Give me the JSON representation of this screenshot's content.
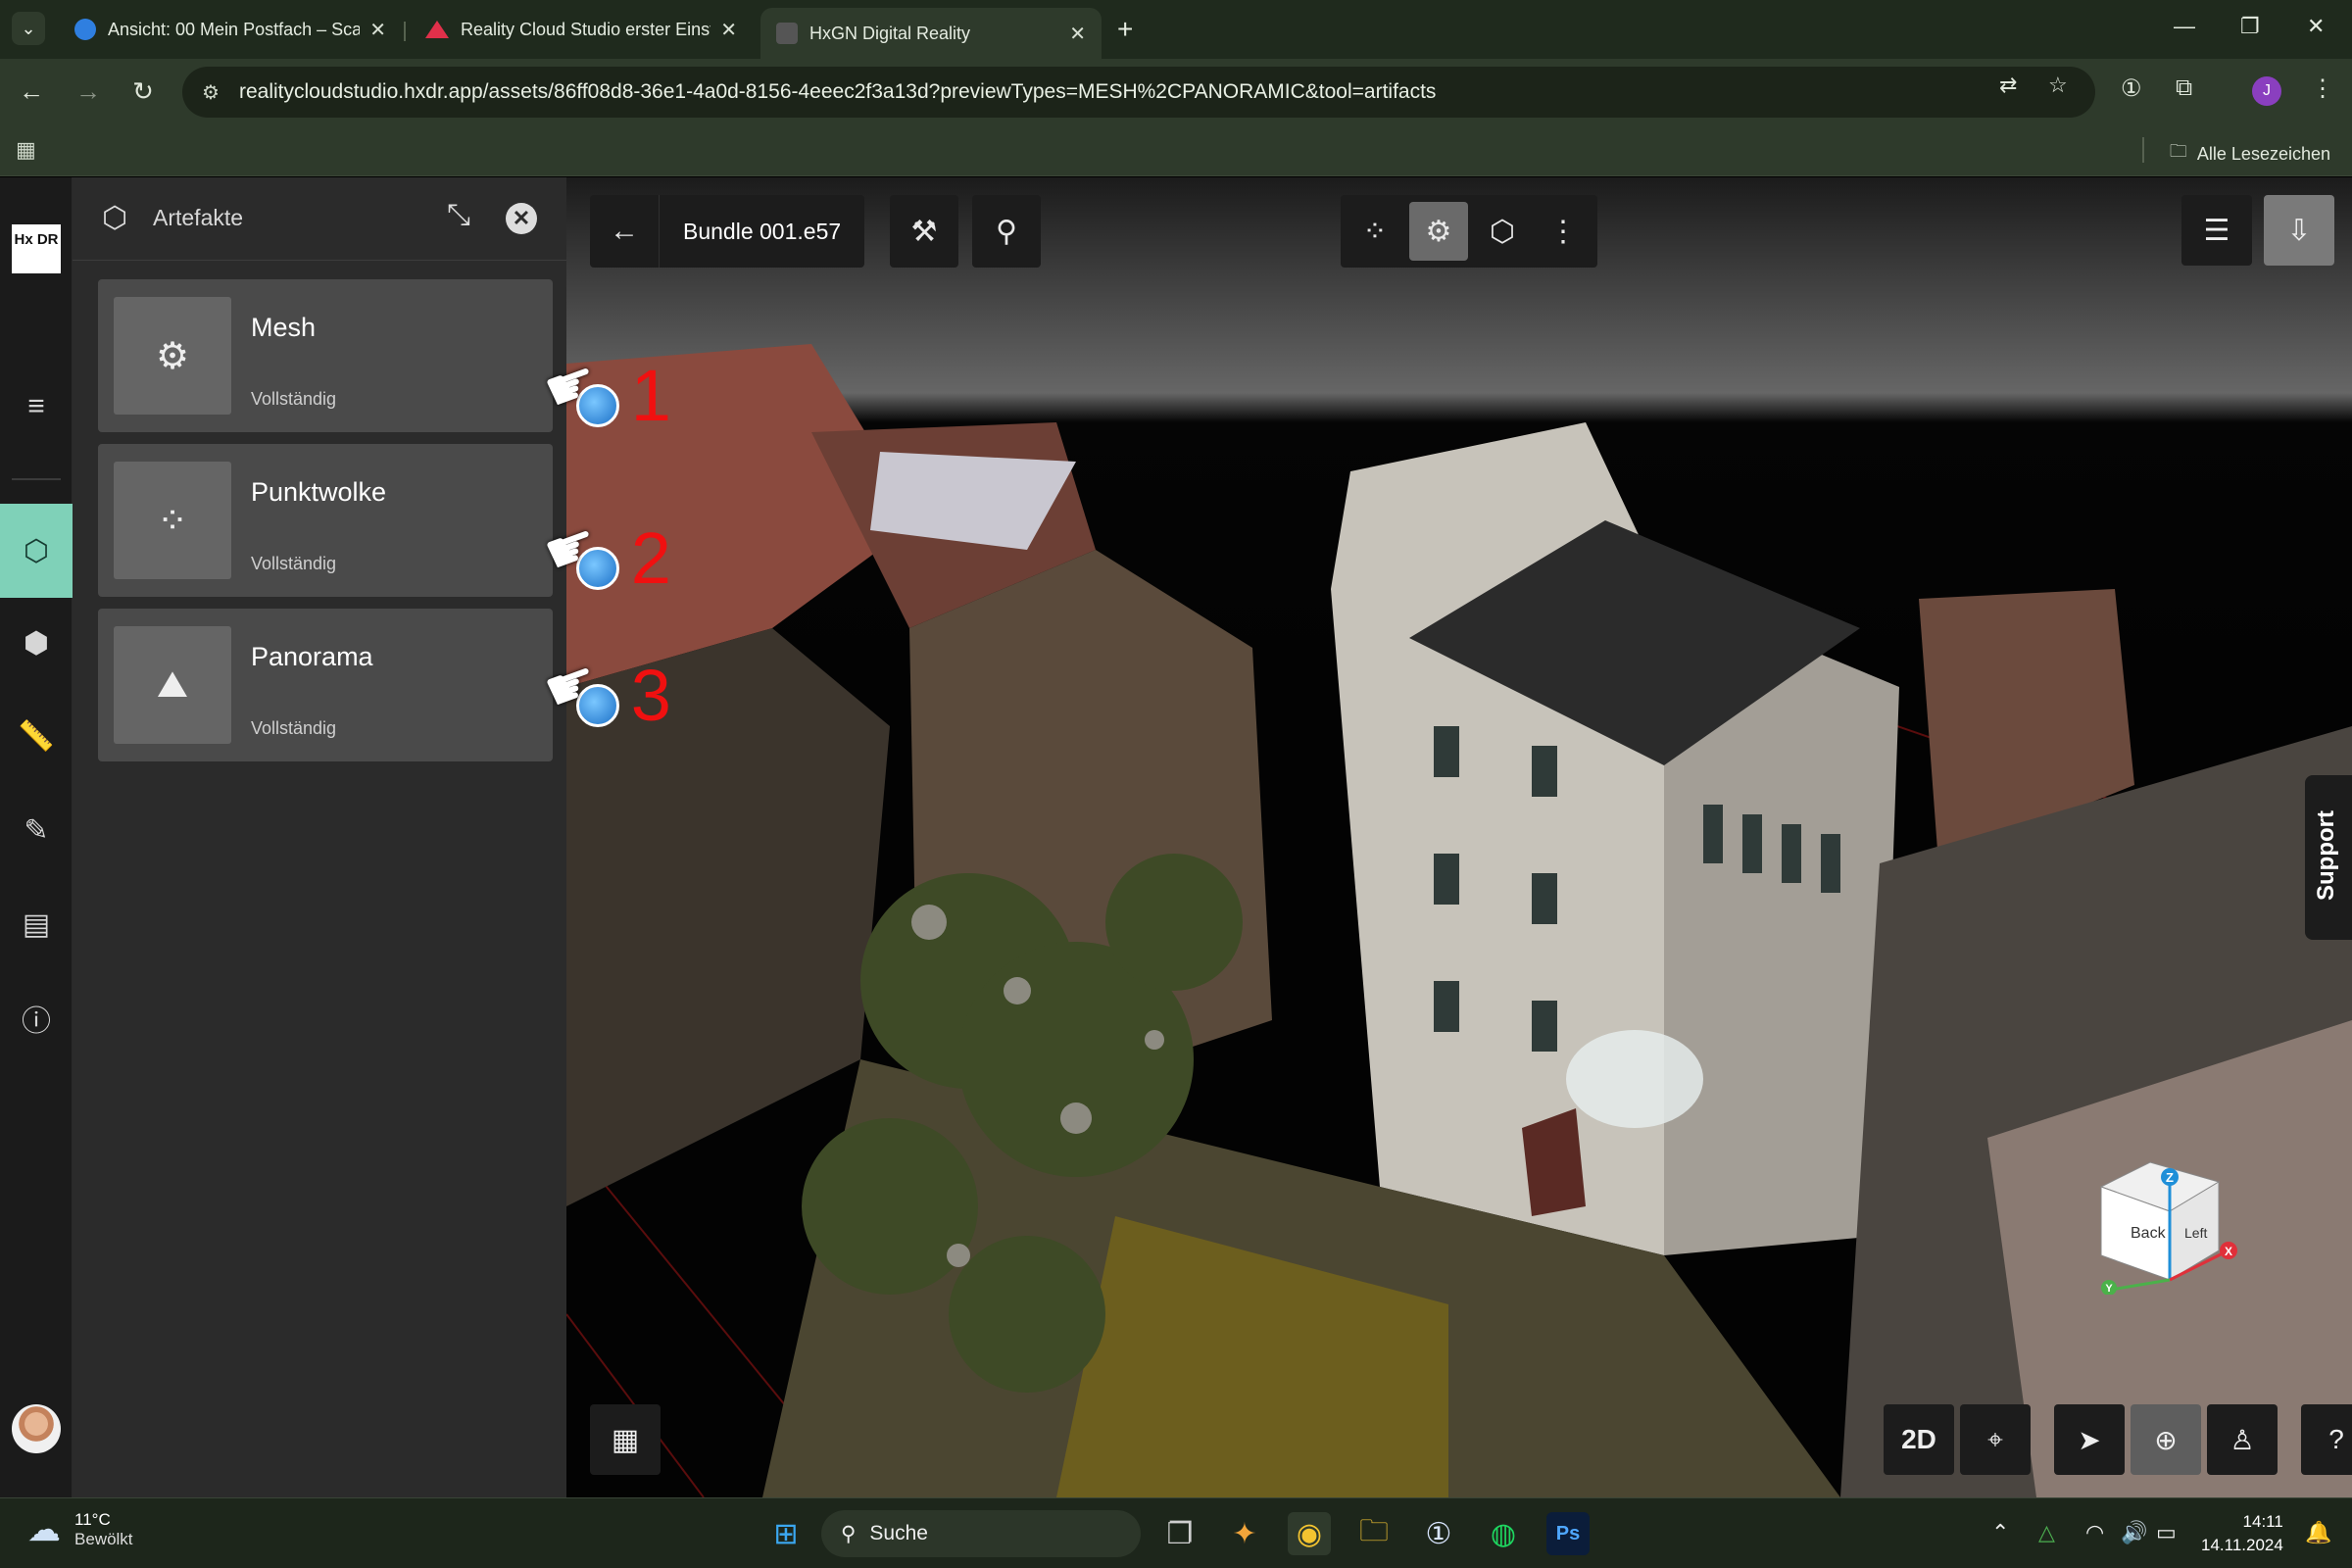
{
  "browser": {
    "tabs": [
      {
        "title": "Ansicht: 00 Mein Postfach – Sca",
        "color": "#2f7fe0"
      },
      {
        "title": "Reality Cloud Studio erster Einst",
        "color": "#e0304a"
      },
      {
        "title": "HxGN Digital Reality",
        "color": "#cccccc"
      }
    ],
    "url": "realitycloudstudio.hxdr.app/assets/86ff08d8-36e1-4a0d-8156-4eeec2f3a13d?previewTypes=MESH%2CPANORAMIC&tool=artifacts",
    "profile_initial": "J",
    "bookmarks_all": "Alle Lesezeichen"
  },
  "app": {
    "logo": "Hx DR",
    "panel": {
      "title": "Artefakte",
      "artifacts": [
        {
          "name": "Mesh",
          "status": "Vollständig",
          "icon": "mesh-icon",
          "glyph": "⚙"
        },
        {
          "name": "Punktwolke",
          "status": "Vollständig",
          "icon": "point-cloud-icon",
          "glyph": "⁘"
        },
        {
          "name": "Panorama",
          "status": "Vollständig",
          "icon": "panorama-icon",
          "glyph": "⛰"
        }
      ]
    },
    "annotations": [
      "1",
      "2",
      "3"
    ],
    "viewer": {
      "bundle_name": "Bundle 001.e57",
      "support_label": "Support",
      "mode_2d_label": "2D",
      "navcube": {
        "face_front": "Back",
        "face_side": "Left",
        "axis_z": "Z",
        "axis_x": "X",
        "axis_y": "Y"
      }
    }
  },
  "taskbar": {
    "weather_temp": "11°C",
    "weather_desc": "Bewölkt",
    "search_label": "Suche",
    "time": "14:11",
    "date": "14.11.2024"
  }
}
